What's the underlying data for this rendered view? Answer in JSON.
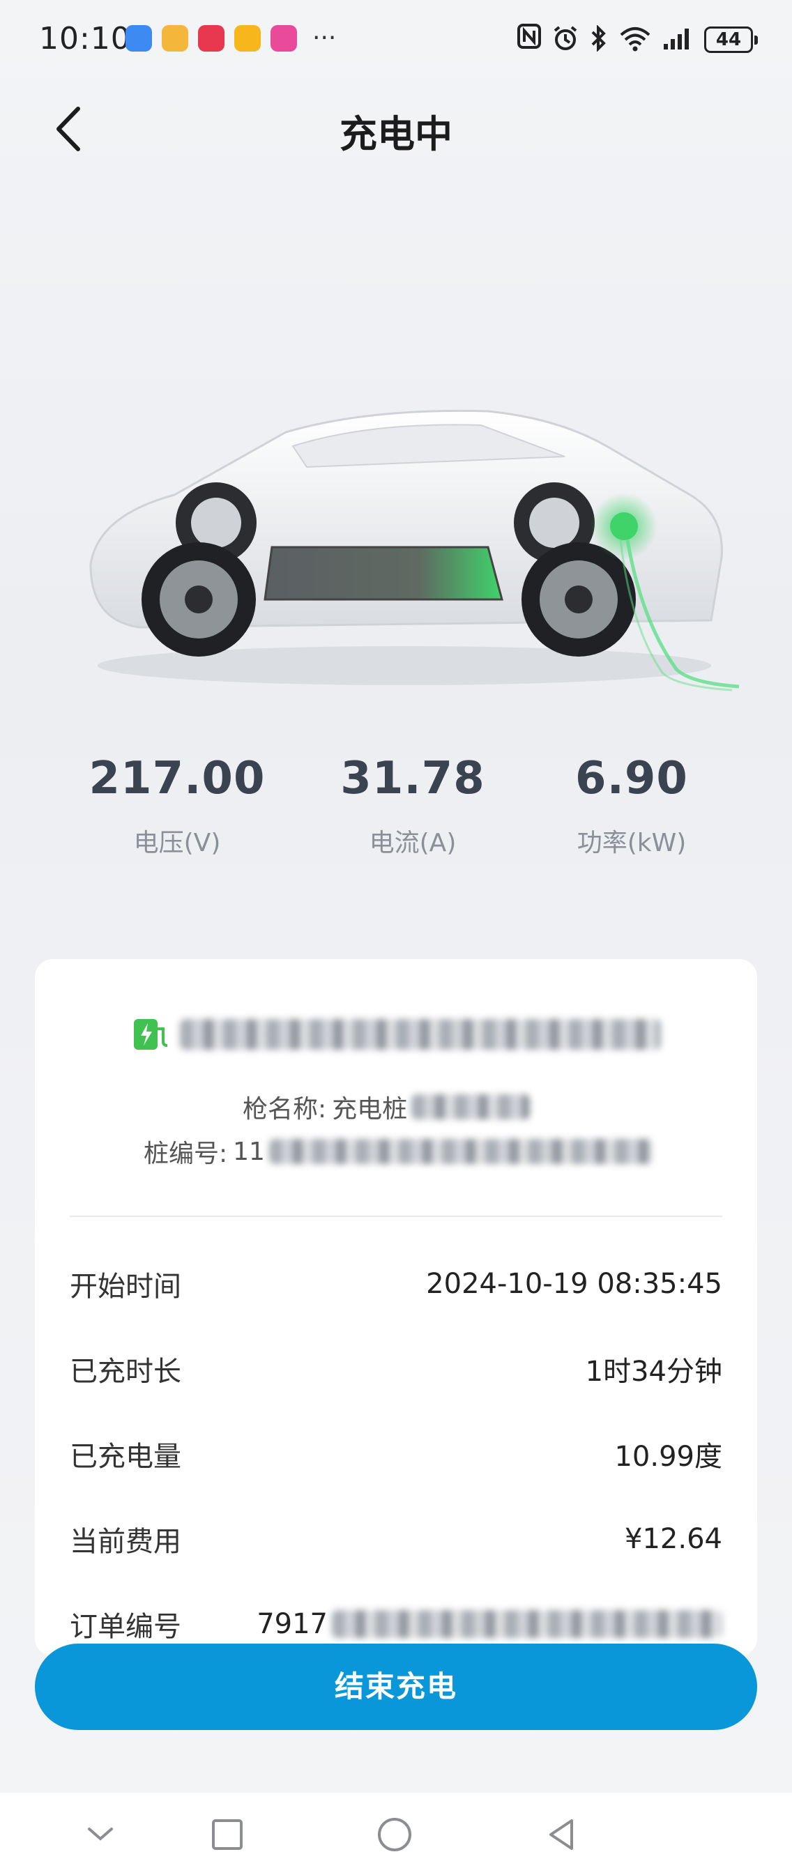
{
  "status_bar": {
    "time": "10:10",
    "more": "···",
    "battery": "44",
    "app_icons": [
      {
        "name": "clock-app-icon",
        "color": "#3d8bf2"
      },
      {
        "name": "weibo-app-icon",
        "color": "#f5b73b"
      },
      {
        "name": "red-heart-app-icon",
        "color": "#e8384f"
      },
      {
        "name": "yellow-app-icon",
        "color": "#f6b61c"
      },
      {
        "name": "pink-app-icon",
        "color": "#e94b9a"
      }
    ]
  },
  "header": {
    "title": "充电中"
  },
  "metrics": [
    {
      "value": "217.00",
      "label": "电压(V)"
    },
    {
      "value": "31.78",
      "label": "电流(A)"
    },
    {
      "value": "6.90",
      "label": "功率(kW)"
    }
  ],
  "station": {
    "gun_name_label": "枪名称:",
    "gun_name_prefix": "充电桩",
    "pile_no_label": "桩编号:",
    "pile_no_prefix": "11"
  },
  "details": [
    {
      "key": "开始时间",
      "value": "2024-10-19 08:35:45"
    },
    {
      "key": "已充时长",
      "value": "1时34分钟"
    },
    {
      "key": "已充电量",
      "value": "10.99度"
    },
    {
      "key": "当前费用",
      "value": "¥12.64"
    }
  ],
  "order": {
    "key": "订单编号",
    "value_prefix": "7917"
  },
  "actions": {
    "end_label": "结束充电"
  },
  "colors": {
    "accent": "#0a97d9",
    "charge_green": "#3fd36a"
  }
}
